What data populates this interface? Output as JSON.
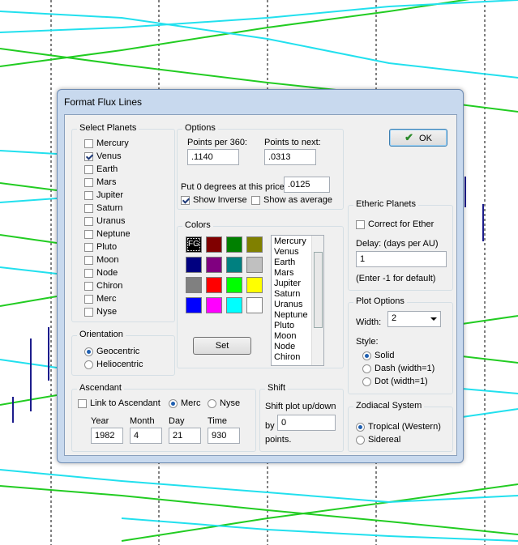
{
  "dialog": {
    "title": "Format Flux Lines",
    "ok_label": "OK"
  },
  "select_planets": {
    "title": "Select Planets",
    "items": [
      {
        "label": "Mercury",
        "checked": false
      },
      {
        "label": "Venus",
        "checked": true
      },
      {
        "label": "Earth",
        "checked": false
      },
      {
        "label": "Mars",
        "checked": false
      },
      {
        "label": "Jupiter",
        "checked": false
      },
      {
        "label": "Saturn",
        "checked": false
      },
      {
        "label": "Uranus",
        "checked": false
      },
      {
        "label": "Neptune",
        "checked": false
      },
      {
        "label": "Pluto",
        "checked": false
      },
      {
        "label": "Moon",
        "checked": false
      },
      {
        "label": "Node",
        "checked": false
      },
      {
        "label": "Chiron",
        "checked": false
      },
      {
        "label": "Merc",
        "checked": false
      },
      {
        "label": "Nyse",
        "checked": false
      }
    ]
  },
  "options": {
    "title": "Options",
    "points_per_360_label": "Points per 360:",
    "points_per_360_value": ".1140",
    "points_to_next_label": "Points to next:",
    "points_to_next_value": ".0313",
    "zero_degrees_label": "Put 0 degrees at this price:",
    "zero_degrees_value": ".0125",
    "show_inverse_label": "Show Inverse",
    "show_inverse_checked": true,
    "show_as_average_label": "Show as average",
    "show_as_average_checked": false
  },
  "colors": {
    "title": "Colors",
    "fg_label": "FG",
    "swatches": [
      "#000000",
      "#800000",
      "#008000",
      "#808000",
      "#000080",
      "#800080",
      "#008080",
      "#c0c0c0",
      "#808080",
      "#ff0000",
      "#00ff00",
      "#ffff00",
      "#0000ff",
      "#ff00ff",
      "#00ffff",
      "#ffffff"
    ],
    "set_label": "Set",
    "list_items": [
      "Mercury",
      "Venus",
      "Earth",
      "Mars",
      "Jupiter",
      "Saturn",
      "Uranus",
      "Neptune",
      "Pluto",
      "Moon",
      "Node",
      "Chiron"
    ]
  },
  "orientation": {
    "title": "Orientation",
    "geocentric_label": "Geocentric",
    "heliocentric_label": "Heliocentric",
    "selected": "geocentric"
  },
  "ascendant": {
    "title": "Ascendant",
    "link_label": "Link to Ascendant",
    "link_checked": false,
    "merc_label": "Merc",
    "nyse_label": "Nyse",
    "selected": "merc",
    "year_label": "Year",
    "year_value": "1982",
    "month_label": "Month",
    "month_value": "4",
    "day_label": "Day",
    "day_value": "21",
    "time_label": "Time",
    "time_value": "930"
  },
  "shift": {
    "title": "Shift",
    "line1": "Shift plot up/down",
    "by_label": "by",
    "value": "0",
    "points_label": "points."
  },
  "etheric": {
    "title": "Etheric Planets",
    "correct_label": "Correct for Ether",
    "correct_checked": false,
    "delay_label": "Delay: (days per AU)",
    "delay_value": "1",
    "hint": "(Enter -1 for default)"
  },
  "plot_options": {
    "title": "Plot Options",
    "width_label": "Width:",
    "width_value": "2",
    "style_label": "Style:",
    "solid_label": "Solid",
    "dash_label": "Dash (width=1)",
    "dot_label": "Dot (width=1)",
    "selected": "solid"
  },
  "zodiacal": {
    "title": "Zodiacal System",
    "tropical_label": "Tropical (Western)",
    "sidereal_label": "Sidereal",
    "selected": "tropical"
  },
  "colors_theme": {
    "green_line": "#22cc22",
    "cyan_line": "#22e0ee",
    "grid": "#000000",
    "candle": "#1c1c8c"
  }
}
